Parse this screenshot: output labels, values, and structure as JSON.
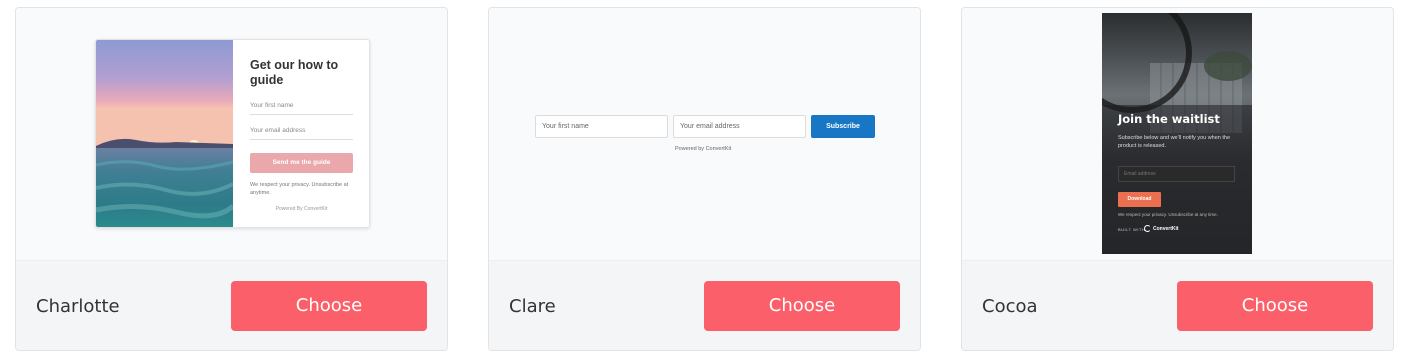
{
  "templates": [
    {
      "name": "Charlotte",
      "choose_label": "Choose",
      "preview": {
        "title": "Get our how to guide",
        "first_name_placeholder": "Your first name",
        "email_placeholder": "Your email address",
        "button_label": "Send me the guide",
        "privacy_text": "We respect your privacy. Unsubscribe at anytime.",
        "powered_by": "Powered By ConvertKit",
        "button_color": "#eba8ab"
      }
    },
    {
      "name": "Clare",
      "choose_label": "Choose",
      "preview": {
        "first_name_placeholder": "Your first name",
        "email_placeholder": "Your email address",
        "button_label": "Subscribe",
        "powered_by": "Powered by ConvertKit",
        "button_color": "#1877c5"
      }
    },
    {
      "name": "Cocoa",
      "choose_label": "Choose",
      "preview": {
        "title": "Join the waitlist",
        "subtitle": "Subscribe below and we'll notify you when the product is released.",
        "email_placeholder": "Email address",
        "button_label": "Download",
        "privacy_text": "We respect your privacy. Unsubscribe at any time.",
        "built_with": "BUILT WITH",
        "brand": "ConvertKit",
        "button_color": "#ec6f4f"
      }
    }
  ],
  "colors": {
    "choose_button": "#fb5f69",
    "card_background": "#f9fafb",
    "footer_background": "#f3f5f7"
  }
}
